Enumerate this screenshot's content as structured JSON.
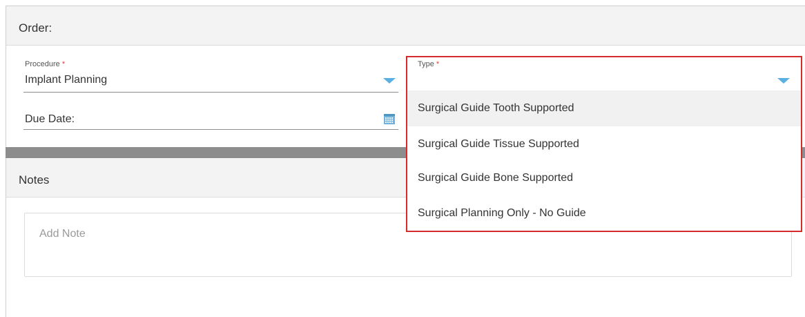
{
  "order": {
    "title": "Order:",
    "procedure": {
      "label": "Procedure",
      "required_mark": "*",
      "value": "Implant Planning"
    },
    "due_date": {
      "label": "Due Date:"
    },
    "type": {
      "label": "Type",
      "required_mark": "*",
      "options": [
        "Surgical Guide Tooth Supported",
        "Surgical Guide Tissue Supported",
        "Surgical Guide Bone Supported",
        "Surgical Planning Only - No Guide"
      ],
      "highlighted_index": 0
    }
  },
  "notes": {
    "title": "Notes",
    "placeholder": "Add Note"
  },
  "colors": {
    "accent_caret": "#5ab0e2",
    "focus_border": "#d52b2b",
    "required": "#e23a3a"
  },
  "icons": {
    "procedure_dropdown": "chevron-down-icon",
    "type_dropdown": "chevron-down-icon",
    "due_date": "calendar-icon"
  }
}
